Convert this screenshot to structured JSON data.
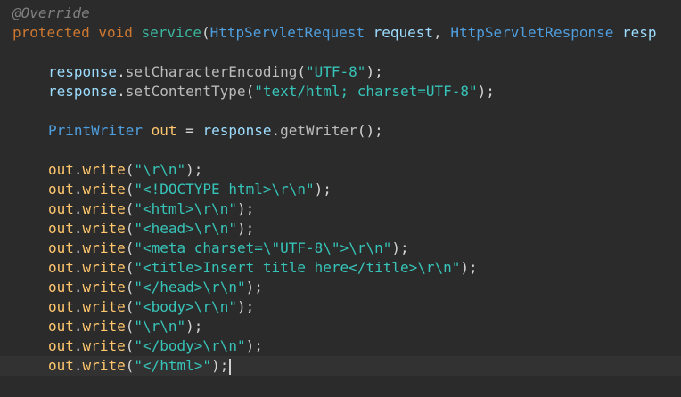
{
  "code": {
    "annotation": "@Override",
    "signature": {
      "kw_protected": "protected",
      "kw_void": "void",
      "method": "service",
      "open": "(",
      "type1": "HttpServletRequest",
      "param1": "request",
      "comma": ",",
      "type2": "HttpServletResponse",
      "param2_partial": "resp"
    },
    "set_encoding": {
      "obj": "response",
      "dot": ".",
      "method": "setCharacterEncoding",
      "open": "(",
      "arg": "\"UTF-8\"",
      "close": ");"
    },
    "set_content_type": {
      "obj": "response",
      "dot": ".",
      "method": "setContentType",
      "open": "(",
      "arg": "\"text/html; charset=UTF-8\"",
      "close": ");"
    },
    "writer_decl": {
      "type": "PrintWriter",
      "var": "out",
      "eq": "=",
      "obj": "response",
      "dot": ".",
      "method": "getWriter",
      "close": "();"
    },
    "write_calls": [
      {
        "obj": "out",
        "dot": ".",
        "method": "write",
        "open": "(",
        "arg": "\"\\r\\n\"",
        "close": ");"
      },
      {
        "obj": "out",
        "dot": ".",
        "method": "write",
        "open": "(",
        "arg": "\"<!DOCTYPE html>\\r\\n\"",
        "close": ");"
      },
      {
        "obj": "out",
        "dot": ".",
        "method": "write",
        "open": "(",
        "arg": "\"<html>\\r\\n\"",
        "close": ");"
      },
      {
        "obj": "out",
        "dot": ".",
        "method": "write",
        "open": "(",
        "arg": "\"<head>\\r\\n\"",
        "close": ");"
      },
      {
        "obj": "out",
        "dot": ".",
        "method": "write",
        "open": "(",
        "arg": "\"<meta charset=\\\"UTF-8\\\">\\r\\n\"",
        "close": ");"
      },
      {
        "obj": "out",
        "dot": ".",
        "method": "write",
        "open": "(",
        "arg": "\"<title>Insert title here</title>\\r\\n\"",
        "close": ");"
      },
      {
        "obj": "out",
        "dot": ".",
        "method": "write",
        "open": "(",
        "arg": "\"</head>\\r\\n\"",
        "close": ");"
      },
      {
        "obj": "out",
        "dot": ".",
        "method": "write",
        "open": "(",
        "arg": "\"<body>\\r\\n\"",
        "close": ");"
      },
      {
        "obj": "out",
        "dot": ".",
        "method": "write",
        "open": "(",
        "arg": "\"\\r\\n\"",
        "close": ");"
      },
      {
        "obj": "out",
        "dot": ".",
        "method": "write",
        "open": "(",
        "arg": "\"</body>\\r\\n\"",
        "close": ");"
      },
      {
        "obj": "out",
        "dot": ".",
        "method": "write",
        "open": "(",
        "arg": "\"</html>\"",
        "close": ");"
      }
    ]
  },
  "colors": {
    "background": "#2b2b2b",
    "current_line": "#323232",
    "keyword": "#cc7832",
    "string": "#37c4b8",
    "type": "#4f9ede",
    "annotation": "#808080"
  }
}
